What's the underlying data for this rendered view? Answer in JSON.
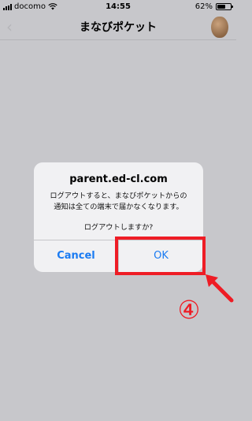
{
  "status_bar": {
    "carrier": "docomo",
    "time": "14:55",
    "battery_text": "62%",
    "battery_level": 0.62
  },
  "nav_bar": {
    "title": "まなびポケット",
    "back_icon": "chevron-left-icon",
    "back_glyph": "‹"
  },
  "dialog": {
    "title": "parent.ed-cl.com",
    "message_lines": [
      "ログアウトすると、まなびポケットからの",
      "通知は全ての端末で届かなくなります。"
    ],
    "question": "ログアウトしますか?",
    "cancel_label": "Cancel",
    "ok_label": "OK"
  },
  "annotation": {
    "step_label": "④",
    "color": "#ee1c25"
  },
  "colors": {
    "background": "#c7c7cb",
    "dialog_bg": "#f1f1f3",
    "button_blue": "#1a7bf2",
    "annotation_red": "#ee1c25"
  }
}
